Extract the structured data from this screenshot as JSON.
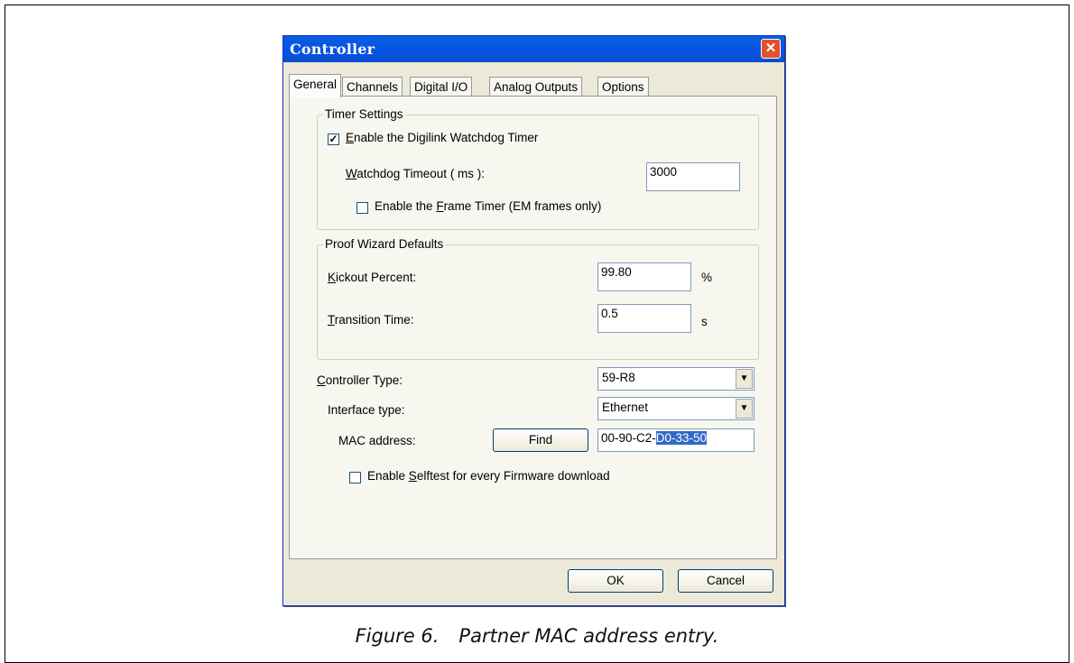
{
  "dialog": {
    "title": "Controller"
  },
  "tabs": [
    "General",
    "Channels",
    "Digital I/O",
    "Analog Outputs",
    "Options"
  ],
  "timer": {
    "group_label": "Timer Settings",
    "watchdog_enable": {
      "pre": "",
      "ul": "E",
      "post": "nable the Digilink Watchdog Timer",
      "checked": true
    },
    "watchdog_timeout": {
      "pre": "",
      "ul": "W",
      "post": "atchdog Timeout ( ms ):",
      "value": "3000"
    },
    "frame_timer": {
      "pre": "Enable the ",
      "ul": "F",
      "post": "rame Timer (EM frames only)",
      "checked": false
    }
  },
  "proof": {
    "group_label": "Proof Wizard Defaults",
    "kickout": {
      "pre": "",
      "ul": "K",
      "post": "ickout Percent:",
      "value": "99.80",
      "unit": "%"
    },
    "transition": {
      "pre": "",
      "ul": "T",
      "post": "ransition Time:",
      "value": "0.5",
      "unit": "s"
    }
  },
  "controller_type": {
    "pre": "",
    "ul": "C",
    "post": "ontroller Type:",
    "value": "59-R8"
  },
  "interface_type": {
    "label": "Interface type:",
    "value": "Ethernet"
  },
  "mac": {
    "label": "MAC address:",
    "find_label": "Find",
    "value_plain": "00-90-C2-",
    "value_selected": "D0-33-50"
  },
  "selftest": {
    "pre": "Enable ",
    "ul": "S",
    "post": "elftest for every Firmware download",
    "checked": false
  },
  "buttons": {
    "ok": "OK",
    "cancel": "Cancel"
  },
  "caption": {
    "number": "Figure 6.",
    "text": "Partner MAC address entry."
  }
}
